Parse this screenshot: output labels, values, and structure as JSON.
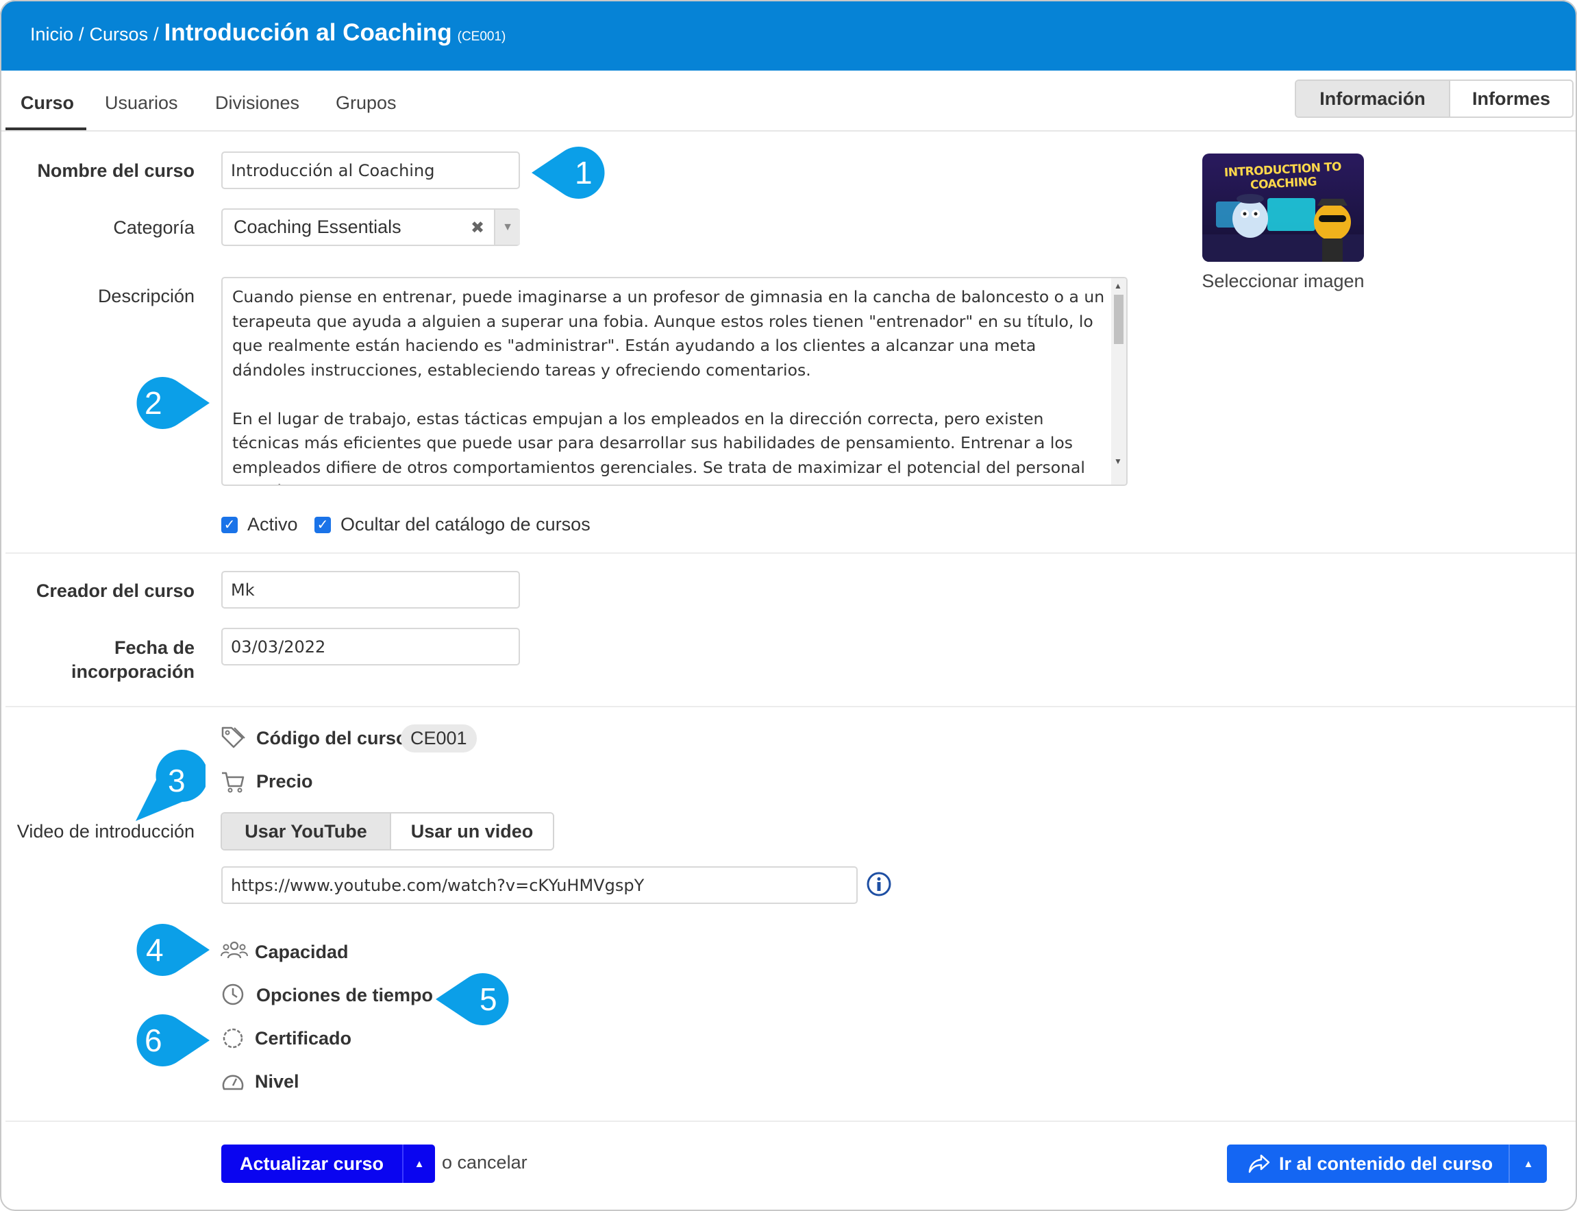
{
  "breadcrumb": {
    "home": "Inicio",
    "sep1": "/",
    "courses": "Cursos",
    "sep2": "/",
    "title": "Introducción al Coaching",
    "code": "(CE001)"
  },
  "tabs": [
    "Curso",
    "Usuarios",
    "Divisiones",
    "Grupos"
  ],
  "view_toggle": {
    "info": "Información",
    "reports": "Informes"
  },
  "form": {
    "name_label": "Nombre del curso",
    "name_value": "Introducción al Coaching",
    "category_label": "Categoría",
    "category_value": "Coaching Essentials",
    "description_label": "Descripción",
    "description_value": "Cuando piense en entrenar, puede imaginarse a un profesor de gimnasia en la cancha de baloncesto o a un terapeuta que ayuda a alguien a superar una fobia. Aunque estos roles tienen \"entrenador\" en su título, lo que realmente están haciendo es \"administrar\". Están ayudando a los clientes a alcanzar una meta dándoles instrucciones, estableciendo tareas y ofreciendo comentarios.\n\nEn el lugar de trabajo, estas tácticas empujan a los empleados en la dirección correcta, pero existen técnicas más eficientes que puede usar para desarrollar sus habilidades de pensamiento. Entrenar a los empleados difiere de otros comportamientos gerenciales. Se trata de maximizar el potencial del personal alentándolos a",
    "active_label": "Activo",
    "hide_label": "Ocultar del catálogo de cursos",
    "creator_label": "Creador del curso",
    "creator_value": "Mk",
    "date_label_1": "Fecha de",
    "date_label_2": "incorporación",
    "date_value": "03/03/2022",
    "code_label": "Código del curso",
    "code_value": "CE001",
    "price_label": "Precio",
    "video_label": "Video de introducción",
    "video_youtube": "Usar YouTube",
    "video_file": "Usar un video",
    "video_url": "https://www.youtube.com/watch?v=cKYuHMVgspY",
    "capacity_label": "Capacidad",
    "time_label": "Opciones de tiempo",
    "certificate_label": "Certificado",
    "level_label": "Nivel"
  },
  "image": {
    "select_label": "Seleccionar imagen",
    "thumb_text": "INTRODUCTION TO COACHING"
  },
  "footer": {
    "update": "Actualizar curso",
    "cancel": "o cancelar",
    "goto": "Ir al contenido del curso"
  },
  "callouts": [
    "1",
    "2",
    "3",
    "4",
    "5",
    "6"
  ],
  "colors": {
    "header": "#0683d6",
    "callout": "#0b9fe8",
    "primary": "#0a05f0",
    "secondary": "#1466f3"
  }
}
